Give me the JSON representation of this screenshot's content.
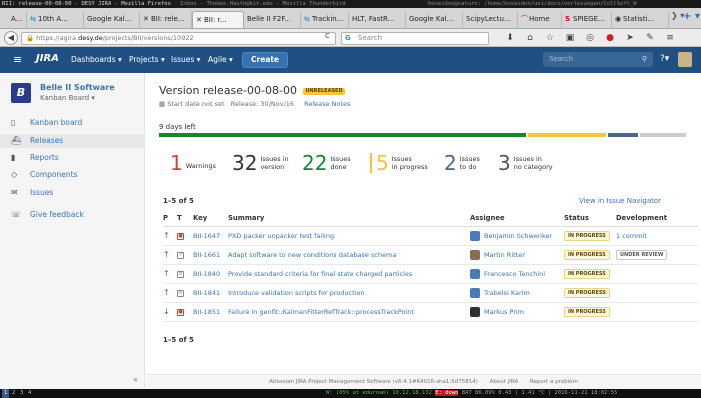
{
  "wm": {
    "title": "BII: release-00-08-00 - DESY JIRA - Mozilla Firefox",
    "mid": "Inbox - Thomas.Hauth@kit.edu - Mozilla Thunderbird",
    "right": "hoseidon@saturn: /home/hoseidon/uni/docs/vorlesungen/CollSoft_W",
    "workspaces": [
      "1",
      "2",
      "3",
      "4"
    ],
    "status_ok": "W: (05% at eduroam) 10.12.18.132",
    "status_bad": "E: down",
    "status_rest": "BAT 86.09% 0.43 | 1.41 °C | 2016-11-21 18:02:55"
  },
  "tabs": [
    {
      "icon": "",
      "label": "A..."
    },
    {
      "icon": "⇆",
      "label": "10th A..."
    },
    {
      "icon": "",
      "label": "Google Kal..."
    },
    {
      "icon": "✕",
      "label": "BII: rele..."
    },
    {
      "icon": "✕",
      "label": "BII: r..."
    },
    {
      "icon": "",
      "label": "Belle II F2F..."
    },
    {
      "icon": "⇆",
      "label": "Trackin..."
    },
    {
      "icon": "",
      "label": "HLT, FastR..."
    },
    {
      "icon": "",
      "label": "Google Kal..."
    },
    {
      "icon": "",
      "label": "ScipyLectu..."
    },
    {
      "icon": "⌒",
      "label": "Home"
    },
    {
      "icon": "S",
      "label": "SPIEGE..."
    },
    {
      "icon": "◉",
      "label": "Statisti..."
    }
  ],
  "url": {
    "scheme": "https://agira.",
    "domain": "desy.de",
    "path": "/projects/BII/versions/10922",
    "search_placeholder": "Search"
  },
  "jira": {
    "logo": "JIRA",
    "nav": [
      "Dashboards ▾",
      "Projects ▾",
      "Issues ▾",
      "Agile ▾"
    ],
    "create": "Create",
    "search_placeholder": "Search"
  },
  "project": {
    "name": "Belle II Software",
    "board": "Kanban Board ▾",
    "menu": [
      {
        "icon": "▯",
        "label": "Kanban board"
      },
      {
        "icon": "⛴",
        "label": "Releases"
      },
      {
        "icon": "▮",
        "label": "Reports"
      },
      {
        "icon": "◇",
        "label": "Components"
      },
      {
        "icon": "✉",
        "label": "Issues"
      },
      {
        "icon": "☏",
        "label": "Give feedback"
      }
    ]
  },
  "version": {
    "title": "Version release-00-08-00",
    "badge": "UNRELEASED",
    "start": "Start date not set",
    "release": "Release: 30/Nov/16",
    "notes": "Release Notes",
    "days_left": "9 days left",
    "progress": {
      "done": 0.697,
      "in_progress": 0.151,
      "todo": 0.061,
      "rest": 0.091
    }
  },
  "stats": [
    {
      "num": "1",
      "label": "Warnings",
      "label2": "",
      "color": "#d04437"
    },
    {
      "num": "32",
      "label": "Issues in",
      "label2": "version",
      "color": "#333"
    },
    {
      "num": "22",
      "label": "Issues",
      "label2": "done",
      "color": "#14892c"
    },
    {
      "num": "5",
      "label": "Issues",
      "label2": "in progress",
      "color": "#f6c342"
    },
    {
      "num": "2",
      "label": "Issues",
      "label2": "to do",
      "color": "#4a6785"
    },
    {
      "num": "3",
      "label": "Issues in",
      "label2": "no category",
      "color": "#555"
    }
  ],
  "table": {
    "count": "1–5 of 5",
    "navigator": "View in Issue Navigator",
    "headers": [
      "P",
      "T",
      "Key",
      "Summary",
      "Assignee",
      "Status",
      "Development"
    ],
    "rows": [
      {
        "prio": "up",
        "type": "bug",
        "key": "BII-1647",
        "summary": "PXD packer unpacker test failing",
        "assignee": "Benjamin Schwenker",
        "status": "IN PROGRESS",
        "dev": "1 commit",
        "dev_kind": "link"
      },
      {
        "prio": "up",
        "type": "task",
        "key": "BII-1661",
        "summary": "Adapt software to new conditions database schema",
        "assignee": "Martin Ritter",
        "status": "IN PROGRESS",
        "dev": "UNDER REVIEW",
        "dev_kind": "lozenge"
      },
      {
        "prio": "up",
        "type": "task",
        "key": "BII-1840",
        "summary": "Provide standard criteria for final state charged particles",
        "assignee": "Francesco Tenchini",
        "status": "IN PROGRESS",
        "dev": "",
        "dev_kind": "none"
      },
      {
        "prio": "up",
        "type": "task",
        "key": "BII-1841",
        "summary": "Introduce validation scripts for production",
        "assignee": "Trabelsi Karim",
        "status": "IN PROGRESS",
        "dev": "",
        "dev_kind": "none"
      },
      {
        "prio": "down",
        "type": "bug",
        "key": "BII-1851",
        "summary": "Failure in genfit::KalmanFitterRefTrack::processTrackPoint",
        "assignee": "Markus Prim",
        "status": "IN PROGRESS",
        "dev": "",
        "dev_kind": "none"
      }
    ]
  },
  "footer": {
    "text": "Atlassian JIRA Project Management Software (v6.4.1#64016-sha1:5d75814)",
    "about": "About JIRA",
    "report": "Report a problem"
  },
  "colors": {
    "header": "#205081",
    "link": "#3b73af",
    "done": "#14892c",
    "in_progress": "#f6c342",
    "todo": "#4a6785"
  }
}
